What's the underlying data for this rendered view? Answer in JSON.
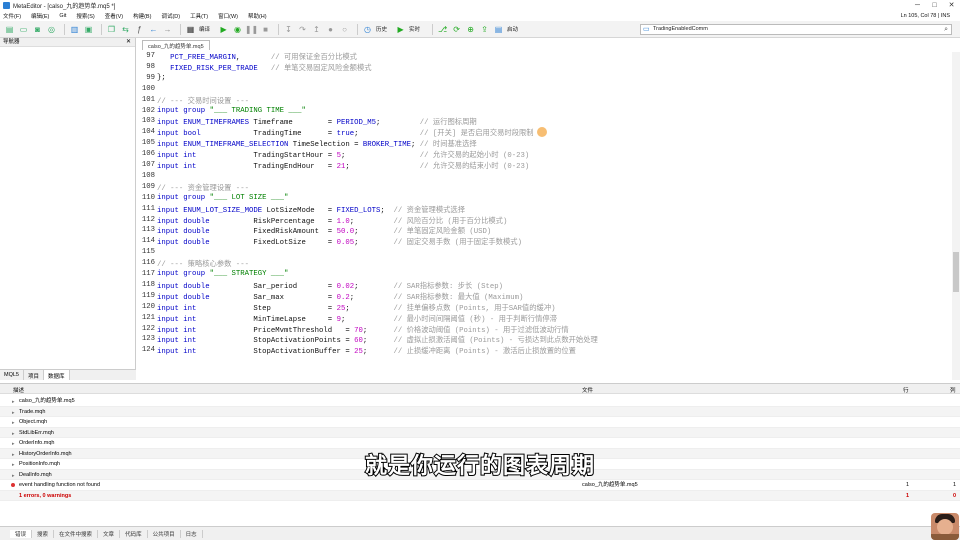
{
  "window": {
    "title": "MetaEditor - [calso_九的趋势单.mq5 *]",
    "controls": [
      "─",
      "□",
      "✕"
    ]
  },
  "menu": {
    "items": [
      "文件(F)",
      "编辑(E)",
      "Git",
      "搜索(S)",
      "查看(V)",
      "构建(B)",
      "调试(D)",
      "工具(T)",
      "窗口(W)",
      "帮助(H)"
    ],
    "cursor_position": "Ln 105, Col 78 | INS"
  },
  "toolbar": {
    "compile_label": "编译",
    "history_label": "历史",
    "realtime_label": "实时",
    "start_label": "启动",
    "search_value": "TradingEnabledComm",
    "search_icon": "search-icon"
  },
  "left_panel": {
    "title": "导航器",
    "tabs": [
      "MQL5",
      "项目",
      "数据库"
    ]
  },
  "editor": {
    "tab": "calso_九的趋势单.mq5",
    "lines": [
      {
        "n": "97",
        "t": "   PCT_FREE_MARGIN,       // 可用保证金百分比模式"
      },
      {
        "n": "98",
        "t": "   FIXED_RISK_PER_TRADE   // 单笔交易固定风险金额模式"
      },
      {
        "n": "99",
        "t": "};"
      },
      {
        "n": "100",
        "t": ""
      },
      {
        "n": "101",
        "t": "// --- 交易时间设置 ---"
      },
      {
        "n": "102",
        "t": "input group \"___ TRADING TIME ___\""
      },
      {
        "n": "103",
        "t": "input ENUM_TIMEFRAMES Timeframe        = PERIOD_M5;         // 运行图标周期"
      },
      {
        "n": "104",
        "t": "input bool            TradingTime      = true;              // [开关] 是否启用交易时段限制"
      },
      {
        "n": "105",
        "t": "input ENUM_TIMEFRAME_SELECTION TimeSelection = BROKER_TIME; // 时间基准选择"
      },
      {
        "n": "106",
        "t": "input int             TradingStartHour = 5;                 // 允许交易的起始小时 (0-23)"
      },
      {
        "n": "107",
        "t": "input int             TradingEndHour   = 21;                // 允许交易的结束小时 (0-23)"
      },
      {
        "n": "108",
        "t": ""
      },
      {
        "n": "109",
        "t": "// --- 资金管理设置 ---"
      },
      {
        "n": "110",
        "t": "input group \"___ LOT SIZE ___\""
      },
      {
        "n": "111",
        "t": "input ENUM_LOT_SIZE_MODE LotSizeMode   = FIXED_LOTS;  // 资金管理模式选择"
      },
      {
        "n": "112",
        "t": "input double          RiskPercentage   = 1.0;         // 风险百分比 (用于百分比模式)"
      },
      {
        "n": "113",
        "t": "input double          FixedRiskAmount  = 50.0;        // 单笔固定风险金额 (USD)"
      },
      {
        "n": "114",
        "t": "input double          FixedLotSize     = 0.05;        // 固定交易手数 (用于固定手数模式)"
      },
      {
        "n": "115",
        "t": ""
      },
      {
        "n": "116",
        "t": "// --- 策略核心参数 ---"
      },
      {
        "n": "117",
        "t": "input group \"___ STRATEGY ___\""
      },
      {
        "n": "118",
        "t": "input double          Sar_period       = 0.02;        // SAR指标参数: 步长 (Step)"
      },
      {
        "n": "119",
        "t": "input double          Sar_max          = 0.2;         // SAR指标参数: 最大值 (Maximum)"
      },
      {
        "n": "120",
        "t": "input int             Step             = 25;          // 挂单偏移点数 (Points, 用于SAR值的缓冲)"
      },
      {
        "n": "121",
        "t": "input int             MinTimeLapse     = 9;           // 最小时间间隔阈值 (秒) - 用于判断行情停滞"
      },
      {
        "n": "122",
        "t": "input int             PriceMvmtThreshold   = 70;      // 价格波动阈值 (Points) - 用于过滤低波动行情"
      },
      {
        "n": "123",
        "t": "input int             StopActivationPoints = 60;      // 虚拟止损激活阈值 (Points) - 亏损达到此点数开始处理"
      },
      {
        "n": "124",
        "t": "input int             StopActivationBuffer = 25;      // 止损缓冲距离 (Points) - 激活后止损放置的位置"
      }
    ]
  },
  "errors": {
    "headers": [
      "描述",
      "文件",
      "行",
      "列"
    ],
    "rows": [
      {
        "d": "calso_九的趋势单.mq5",
        "f": "",
        "l": "",
        "c": ""
      },
      {
        "d": "Trade.mqh",
        "f": "",
        "l": "",
        "c": ""
      },
      {
        "d": "Object.mqh",
        "f": "",
        "l": "",
        "c": ""
      },
      {
        "d": "StdLibErr.mqh",
        "f": "",
        "l": "",
        "c": ""
      },
      {
        "d": "OrderInfo.mqh",
        "f": "",
        "l": "",
        "c": ""
      },
      {
        "d": "HistoryOrderInfo.mqh",
        "f": "",
        "l": "",
        "c": ""
      },
      {
        "d": "PositionInfo.mqh",
        "f": "",
        "l": "",
        "c": ""
      },
      {
        "d": "DealInfo.mqh",
        "f": "",
        "l": "",
        "c": ""
      },
      {
        "d": "event handling function not found",
        "f": "calso_九的趋势单.mq5",
        "l": "1",
        "c": "1"
      },
      {
        "d": "1 errors, 0 warnings",
        "f": "",
        "l": "1",
        "c": "0"
      }
    ]
  },
  "bottom_tabs": [
    "错误",
    "搜索",
    "在文件中搜索",
    "文章",
    "代码库",
    "公共项目",
    "日志"
  ],
  "subtitle": "就是你运行的图表周期",
  "colors": {
    "keyword": "#0000c8",
    "identifier": "#8a0000",
    "number": "#c000c0",
    "string": "#008000",
    "comment": "#9a9a9a",
    "error": "#d33"
  }
}
